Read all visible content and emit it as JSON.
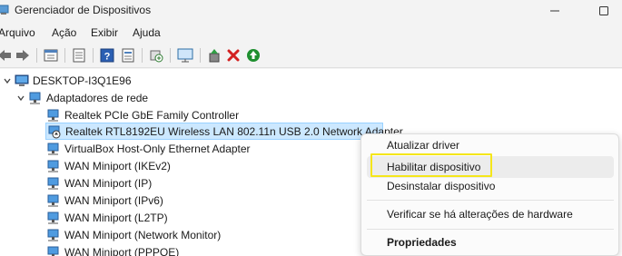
{
  "window": {
    "title": "Gerenciador de Dispositivos"
  },
  "menu": [
    "Arquivo",
    "Ação",
    "Exibir",
    "Ajuda"
  ],
  "toolbar": {
    "icons": [
      "back-arrow-icon",
      "forward-arrow-icon",
      "properties-icon",
      "view-icon",
      "help-icon",
      "action-icon",
      "scan-icon",
      "monitor-icon",
      "update-driver-icon",
      "uninstall-icon",
      "enable-icon"
    ],
    "colors": {
      "uninstall": "#d32020",
      "enable": "#1e8f2f"
    }
  },
  "tree": {
    "computer": "DESKTOP-I3Q1E96",
    "category": "Adaptadores de rede",
    "devices": [
      "Realtek PCIe GbE Family Controller",
      "Realtek RTL8192EU Wireless LAN 802.11n USB 2.0 Network Adapter",
      "VirtualBox Host-Only Ethernet Adapter",
      "WAN Miniport (IKEv2)",
      "WAN Miniport (IP)",
      "WAN Miniport (IPv6)",
      "WAN Miniport (L2TP)",
      "WAN Miniport (Network Monitor)",
      "WAN Miniport (PPPOE)"
    ],
    "selected_index": 1
  },
  "context_menu": {
    "update": "Atualizar driver",
    "enable": "Habilitar dispositivo",
    "uninstall": "Desinstalar dispositivo",
    "scan": "Verificar se há alterações de hardware",
    "properties": "Propriedades",
    "highlight_color": "#f5e61a"
  }
}
